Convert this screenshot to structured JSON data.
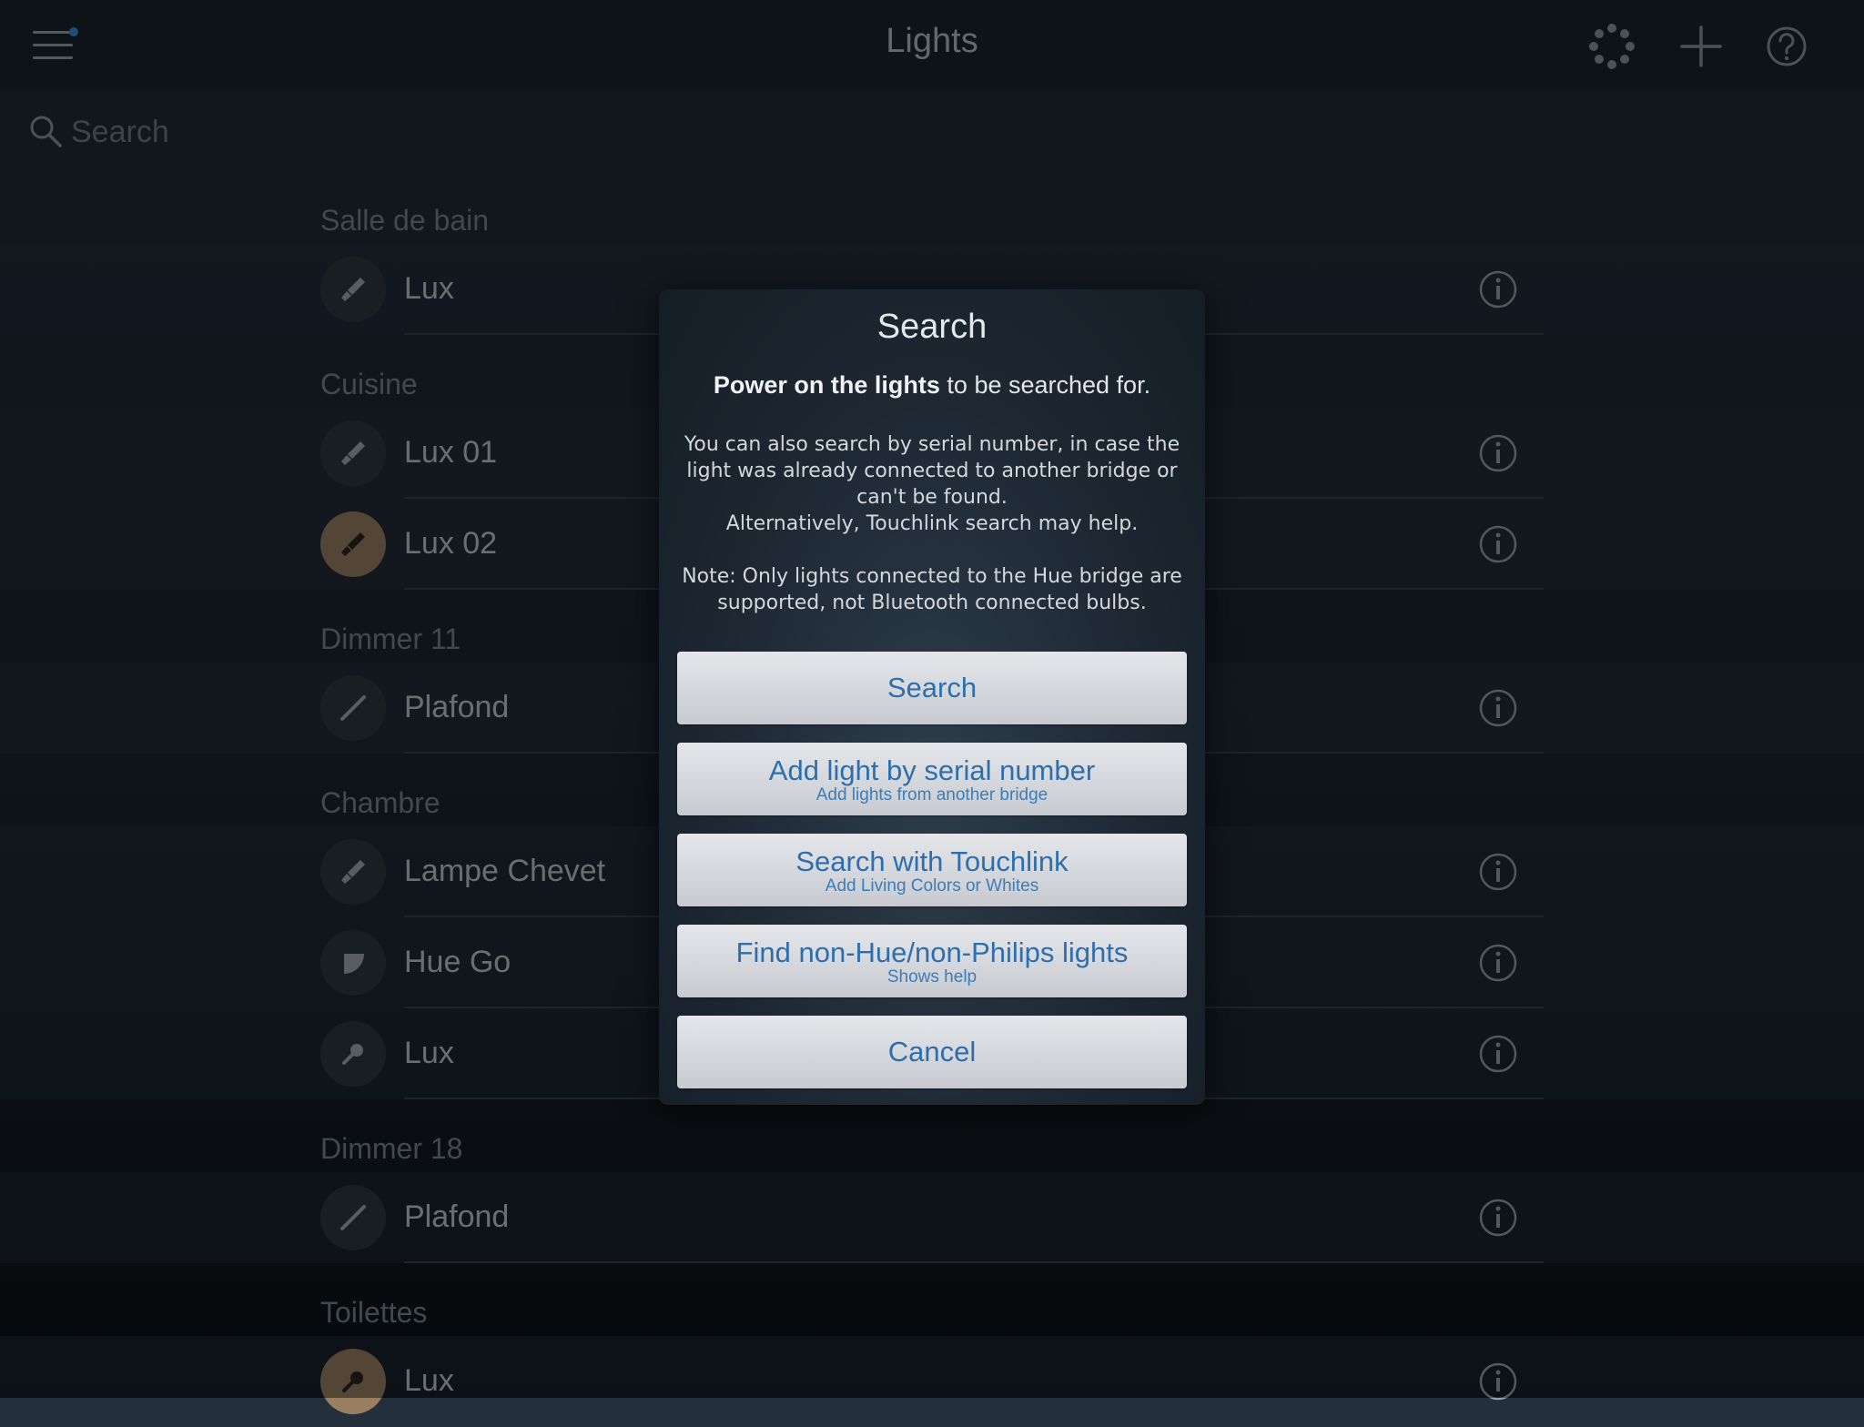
{
  "header": {
    "title": "Lights"
  },
  "search": {
    "placeholder": "Search"
  },
  "sections": [
    {
      "label": "Salle de bain",
      "lights": [
        {
          "name": "Lux",
          "on": false,
          "icon": "bulb-icon"
        }
      ]
    },
    {
      "label": "Cuisine",
      "lights": [
        {
          "name": "Lux 01",
          "on": false,
          "icon": "bulb-icon"
        },
        {
          "name": "Lux 02",
          "on": true,
          "icon": "bulb-icon"
        }
      ]
    },
    {
      "label": "Dimmer 11",
      "lights": [
        {
          "name": "Plafond",
          "on": false,
          "icon": "strip-icon"
        }
      ]
    },
    {
      "label": "Chambre",
      "lights": [
        {
          "name": "Lampe Chevet",
          "on": false,
          "icon": "bulb-icon"
        },
        {
          "name": "Hue Go",
          "on": false,
          "icon": "hue-go-icon"
        },
        {
          "name": "Lux",
          "on": false,
          "icon": "bulb-icon"
        }
      ]
    },
    {
      "label": "Dimmer 18",
      "lights": [
        {
          "name": "Plafond",
          "on": false,
          "icon": "strip-icon"
        }
      ]
    },
    {
      "label": "Toilettes",
      "lights": [
        {
          "name": "Lux",
          "on": true,
          "icon": "bulb-icon"
        }
      ]
    }
  ],
  "dialog": {
    "title": "Search",
    "lead_bold": "Power on the lights",
    "lead_rest": " to be searched for.",
    "body_line1": "You can also search by serial number, in case the light was already connected to another bridge or can't be found.",
    "body_line2": "Alternatively, Touchlink search may help.",
    "body_note": "Note: Only lights connected to the Hue bridge are supported, not Bluetooth connected bulbs.",
    "buttons": {
      "search": {
        "label": "Search"
      },
      "serial": {
        "label": "Add light by serial number",
        "sub": "Add lights from another bridge"
      },
      "touchlink": {
        "label": "Search with Touchlink",
        "sub": "Add Living Colors or Whites"
      },
      "non_hue": {
        "label": "Find non-Hue/non-Philips lights",
        "sub": "Shows help"
      },
      "cancel": {
        "label": "Cancel"
      }
    }
  },
  "colors": {
    "accent": "#2d6fae",
    "light_on": "#9a8063",
    "notification_dot": "#3b8fe0"
  }
}
